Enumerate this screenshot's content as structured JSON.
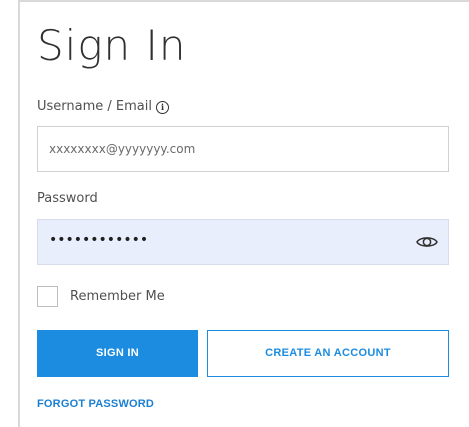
{
  "form": {
    "title": "Sign In",
    "username_label": "Username / Email",
    "info_icon": "info-circle-icon",
    "username_value": "xxxxxxxx@yyyyyyy.com",
    "password_label": "Password",
    "password_value": "••••••••••••",
    "show_password_icon": "eye-icon",
    "remember_me_label": "Remember Me",
    "remember_me_checked": false,
    "sign_in_label": "SIGN IN",
    "create_account_label": "CREATE AN ACCOUNT",
    "forgot_password_label": "FORGOT PASSWORD"
  },
  "colors": {
    "accent": "#1b8ce0",
    "password_field_bg": "#e8eefc"
  }
}
